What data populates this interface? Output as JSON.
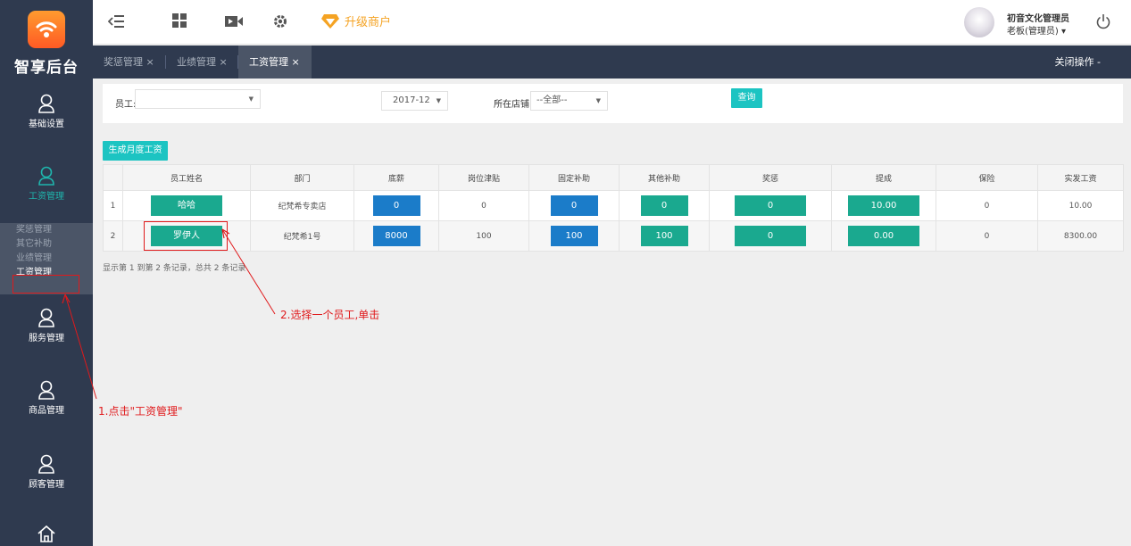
{
  "brand": {
    "logo_text": "智享后台",
    "accent": "#ff7a2a"
  },
  "sidebar": {
    "items": [
      {
        "label": "基础设置",
        "icon": "user-icon"
      },
      {
        "label": "工资管理",
        "icon": "user-icon"
      },
      {
        "label": "服务管理",
        "icon": "user-icon"
      },
      {
        "label": "商品管理",
        "icon": "user-icon"
      },
      {
        "label": "顾客管理",
        "icon": "user-icon"
      }
    ],
    "submenu": [
      "奖惩管理",
      "其它补助",
      "业绩管理",
      "工资管理"
    ]
  },
  "topbar": {
    "upgrade_label": "升级商户",
    "user_name": "初音文化管理员",
    "user_role": "老板(管理员) ▾"
  },
  "tabs": [
    {
      "label": "奖惩管理 ×"
    },
    {
      "label": "业绩管理 ×"
    },
    {
      "label": "工资管理 ×"
    }
  ],
  "close_ops": "关闭操作 -",
  "filter": {
    "employee_label": "员工:",
    "employee_value": "",
    "month_value": "2017-12",
    "store_label": "所在店铺:",
    "store_value": "--全部--",
    "query_button": "查询"
  },
  "generate_button": "生成月度工资",
  "table": {
    "headers": [
      "",
      "员工姓名",
      "部门",
      "底薪",
      "岗位津贴",
      "固定补助",
      "其他补助",
      "奖惩",
      "提成",
      "保险",
      "实发工资"
    ],
    "rows": [
      {
        "no": "1",
        "name": "哈哈",
        "dept": "纪梵希专卖店",
        "base": "0",
        "allowance": "0",
        "fixed": "0",
        "other": "0",
        "bonus": "0",
        "commission": "10.00",
        "insurance": "0",
        "net": "10.00"
      },
      {
        "no": "2",
        "name": "罗伊人",
        "dept": "纪梵希1号",
        "base": "8000",
        "allowance": "100",
        "fixed": "100",
        "other": "100",
        "bonus": "0",
        "commission": "0.00",
        "insurance": "0",
        "net": "8300.00"
      }
    ]
  },
  "summary": "显示第 1 到第 2 条记录，总共 2 条记录",
  "annotations": {
    "step1": "1.点击\"工资管理\"",
    "step2": "2.选择一个员工,单击"
  }
}
